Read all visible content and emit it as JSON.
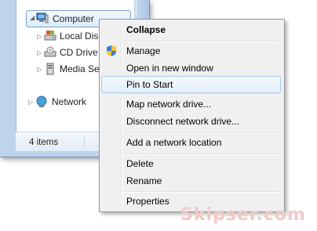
{
  "tree": {
    "items": [
      {
        "label": "Computer",
        "icon": "computer-icon",
        "selected": true
      },
      {
        "label": "Local Disk",
        "icon": "drive-icon"
      },
      {
        "label": "CD Drive",
        "icon": "cd-drive-icon"
      },
      {
        "label": "Media Se",
        "icon": "media-server-icon"
      },
      {
        "label": "Network",
        "icon": "network-icon"
      }
    ]
  },
  "status": {
    "items_count": "4 items"
  },
  "menu": {
    "collapse": "Collapse",
    "manage": "Manage",
    "open_new_window": "Open in new window",
    "pin_to_start": "Pin to Start",
    "map_drive": "Map network drive...",
    "disconnect_drive": "Disconnect network drive...",
    "add_network_location": "Add a network location",
    "delete": "Delete",
    "rename": "Rename",
    "properties": "Properties",
    "highlighted": "Pin to Start"
  },
  "watermark": "Skipser.com",
  "colors": {
    "selection_border": "#7da2ce",
    "highlight_border": "#a8c9ee",
    "frame": "#bfd4ea"
  }
}
